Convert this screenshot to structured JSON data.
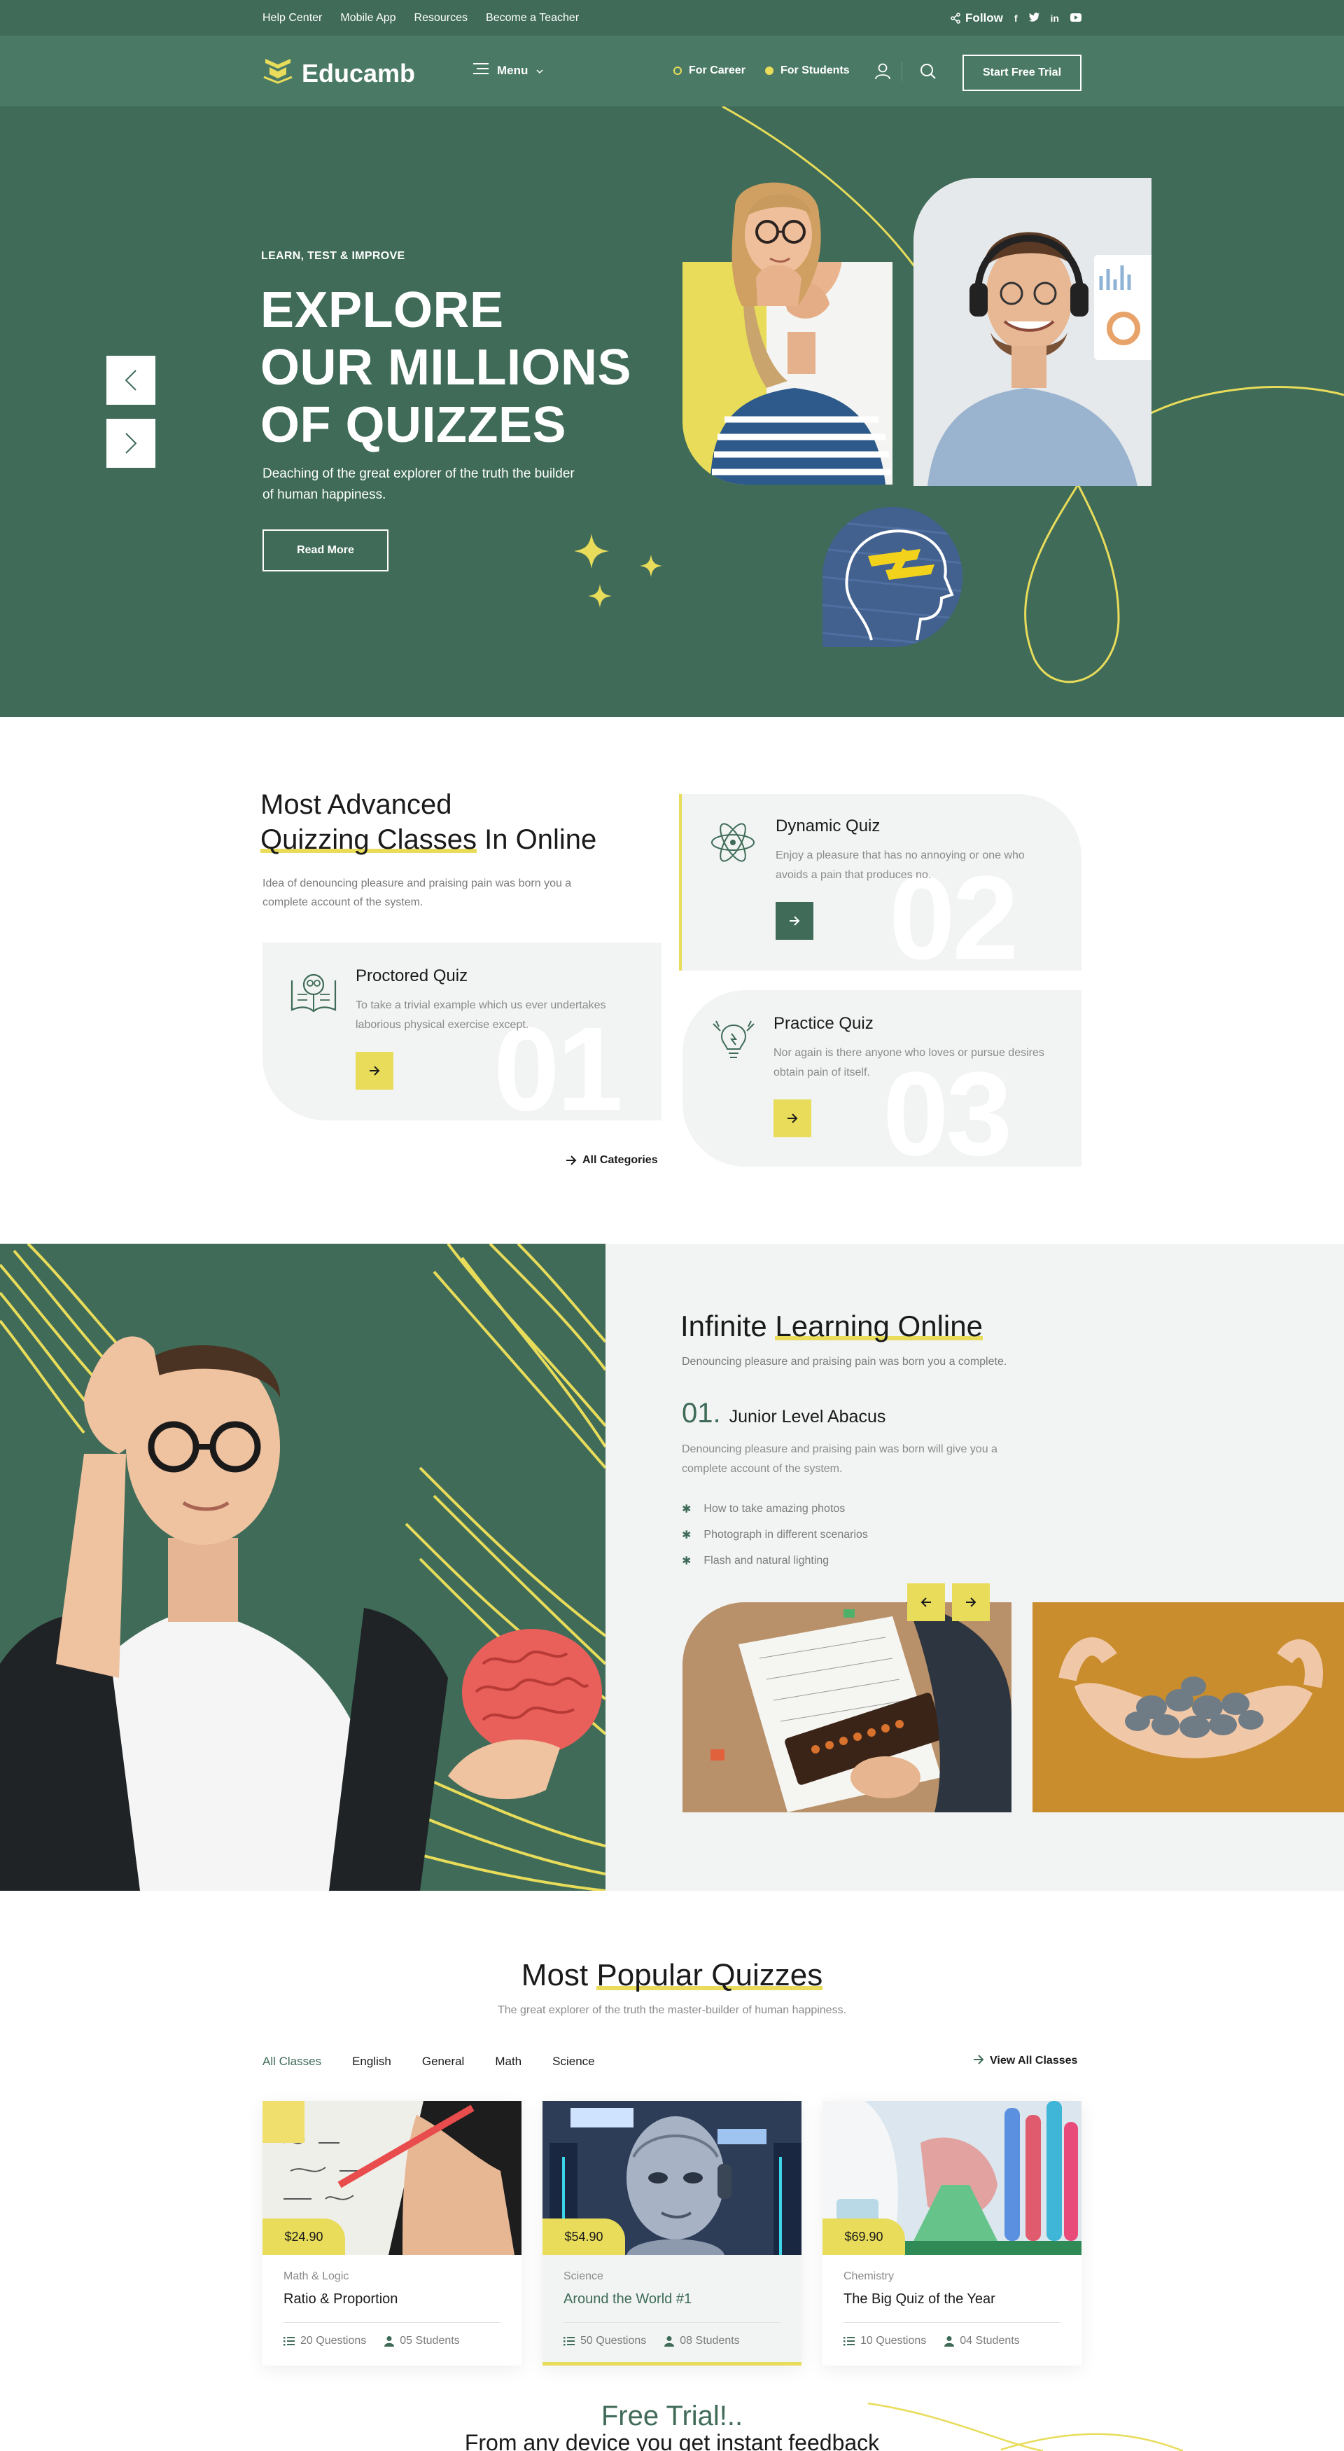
{
  "topbar": {
    "links": [
      "Help Center",
      "Mobile App",
      "Resources",
      "Become a Teacher"
    ],
    "follow_label": "Follow",
    "social_icons": [
      "facebook-icon",
      "twitter-icon",
      "linkedin-icon",
      "youtube-icon"
    ]
  },
  "nav": {
    "brand": "Educamb",
    "menu_label": "Menu",
    "career_label": "For Career",
    "students_label": "For Students",
    "cta_label": "Start Free Trial"
  },
  "hero": {
    "eyebrow": "LEARN, TEST & IMPROVE",
    "title_line1": "EXPLORE",
    "title_line2": "OUR MILLIONS",
    "title_line3": "OF QUIZZES",
    "description": "Deaching of the great explorer of the truth the builder of human happiness.",
    "button_label": "Read More"
  },
  "categories": {
    "title_line1": "Most Advanced",
    "title_highlight": "Quizzing Classes",
    "title_rest": " In Online",
    "description": "Idea of denouncing pleasure and praising pain was born you a complete account of the system.",
    "cards": [
      {
        "num": "01",
        "title": "Proctored Quiz",
        "text": "To take a trivial example which us ever undertakes laborious physical exercise except."
      },
      {
        "num": "02",
        "title": "Dynamic Quiz",
        "text": "Enjoy a pleasure that has no annoying or one who avoids a pain that produces no."
      },
      {
        "num": "03",
        "title": "Practice Quiz",
        "text": "Nor again is there anyone who loves or pursue desires obtain pain of itself."
      }
    ],
    "all_label": "All Categories"
  },
  "learning": {
    "title_pre": "Infinite ",
    "title_highlight": "Learning Online",
    "subtitle": "Denouncing pleasure and praising pain was born you a complete.",
    "item_num": "01.",
    "item_title": "Junior Level Abacus",
    "item_text": "Denouncing pleasure and praising pain was born  will give you a complete account of the system.",
    "bullets": [
      "How to take amazing photos",
      "Photograph in different scenarios",
      "Flash and natural lighting"
    ]
  },
  "popular": {
    "title_pre": "Most ",
    "title_highlight": "Popular Quizzes",
    "subtitle": "The great explorer of the truth the master-builder of human happiness.",
    "tabs": [
      "All Classes",
      "English",
      "General",
      "Math",
      "Science"
    ],
    "view_all": "View All Classes",
    "quizzes": [
      {
        "price": "$24.90",
        "category": "Math & Logic",
        "title": "Ratio & Proportion",
        "questions": "20 Questions",
        "students": "05 Students"
      },
      {
        "price": "$54.90",
        "category": "Science",
        "title": "Around the World #1",
        "questions": "50 Questions",
        "students": "08 Students"
      },
      {
        "price": "$69.90",
        "category": "Chemistry",
        "title": "The Big Quiz of the Year",
        "questions": "10 Questions",
        "students": "04 Students"
      }
    ]
  },
  "free_trial": {
    "title": "Free Trial!..",
    "subtitle": "From any device you get instant feedback"
  },
  "colors": {
    "brand_green": "#3f6b58",
    "accent_yellow": "#e8dc5a",
    "light_bg": "#f1f4f2"
  }
}
